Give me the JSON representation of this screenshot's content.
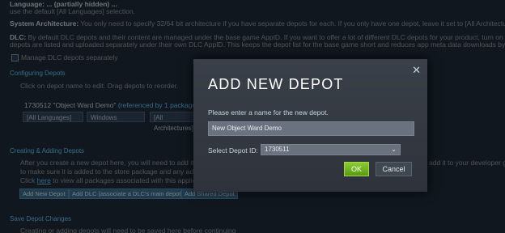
{
  "background": {
    "line_language": "Language: ... (partially hidden) ...",
    "line_language_cont": "use the default [All Languages] selection.",
    "system_arch_label": "System Architecture:",
    "system_arch_text": " You only need to specify 32/64 bit architecture if you have separate depots for each. If you only have one depot, leave it set to [All Architectures]",
    "dlc_label": "DLC:",
    "dlc_text": " By default DLC depots and their content are managed under the base game AppID. If you want to offer a lot of different DLC depots for your product, turn on Manage D",
    "dlc_text_cont": "depots are listed and uploaded separately under their own DLC AppID. This keeps the depot list for the base game short and reduces app meta data downloads by clients",
    "manage_dlc_label": "Manage DLC depots separately",
    "configuring_title": "Configuring Depots",
    "configuring_hint": "Click on depot name to edit. Drag depots to reorder.",
    "depot_row": "1730512 \"Object Ward Demo\"",
    "depot_row_ref": "(referenced by 1 package)",
    "language_select": "[All Languages]",
    "os_select": "Windows",
    "arch_select": "[All Architectures]",
    "creating_title": "Creating & Adding Depots",
    "creating_text1": "After you create a new depot here, you will need to add it to",
    "creating_text1_right": "add it to your developer g",
    "creating_text2": "to make sure it is added to the store package and any additio",
    "creating_text3_pre": "Click ",
    "creating_text3_link": "here",
    "creating_text3_post": " to view all packages associated with this applicatio",
    "btn_add_new_depot": "Add New Depot",
    "btn_add_dlc": "Add DLC (associate a DLC's main depot)",
    "btn_add_shared": "Add Shared Depot",
    "save_title": "Save Depot Changes",
    "save_text": "Creating or adding depots will need to be saved here before continuing"
  },
  "dialog": {
    "title": "ADD NEW DEPOT",
    "close_glyph": "✕",
    "prompt": "Please enter a name for the new depot.",
    "name_value": "New Object Ward Demo",
    "depot_id_label": "Select Depot ID:",
    "depot_id_value": "1730511",
    "ok_label": "OK",
    "cancel_label": "Cancel"
  },
  "colors": {
    "page_bg": "#1e2a38",
    "accent_link": "#66c0f4",
    "ok_green": "#5a9a16",
    "dialog_bg": "#3a4049"
  }
}
